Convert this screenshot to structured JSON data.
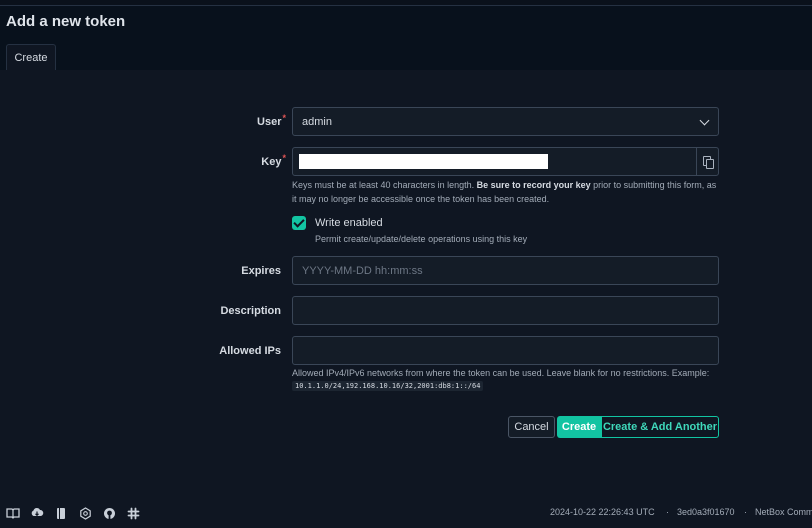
{
  "page": {
    "title": "Add a new token",
    "tab": "Create"
  },
  "form": {
    "user": {
      "label": "User",
      "required_mark": "*",
      "value": "admin"
    },
    "key": {
      "label": "Key",
      "required_mark": "*",
      "help_pre": "Keys must be at least 40 characters in length. ",
      "help_bold": "Be sure to record your key",
      "help_post": " prior to submitting this form, as it may no longer be accessible once the token has been created."
    },
    "write_enabled": {
      "label": "Write enabled",
      "checked": true,
      "help": "Permit create/update/delete operations using this key"
    },
    "expires": {
      "label": "Expires",
      "placeholder": "YYYY-MM-DD hh:mm:ss"
    },
    "description": {
      "label": "Description",
      "value": ""
    },
    "allowed_ips": {
      "label": "Allowed IPs",
      "value": "",
      "help": "Allowed IPv4/IPv6 networks from where the token can be used. Leave blank for no restrictions. Example:",
      "example": "10.1.1.0/24,192.168.10.16/32,2001:db8:1::/64"
    }
  },
  "buttons": {
    "cancel": "Cancel",
    "create": "Create",
    "create_another": "Create & Add Another"
  },
  "footer": {
    "icons": [
      "docs-icon",
      "cloud-download-icon",
      "book-icon",
      "api-icon",
      "github-icon",
      "slack-icon"
    ],
    "timestamp": "2024-10-22 22:26:43 UTC",
    "sep": "·",
    "commit": "3ed0a3f01670",
    "brand": "NetBox Comm"
  },
  "colors": {
    "accent": "#12c4a2",
    "background": "#0f1622",
    "header": "#08111c"
  }
}
